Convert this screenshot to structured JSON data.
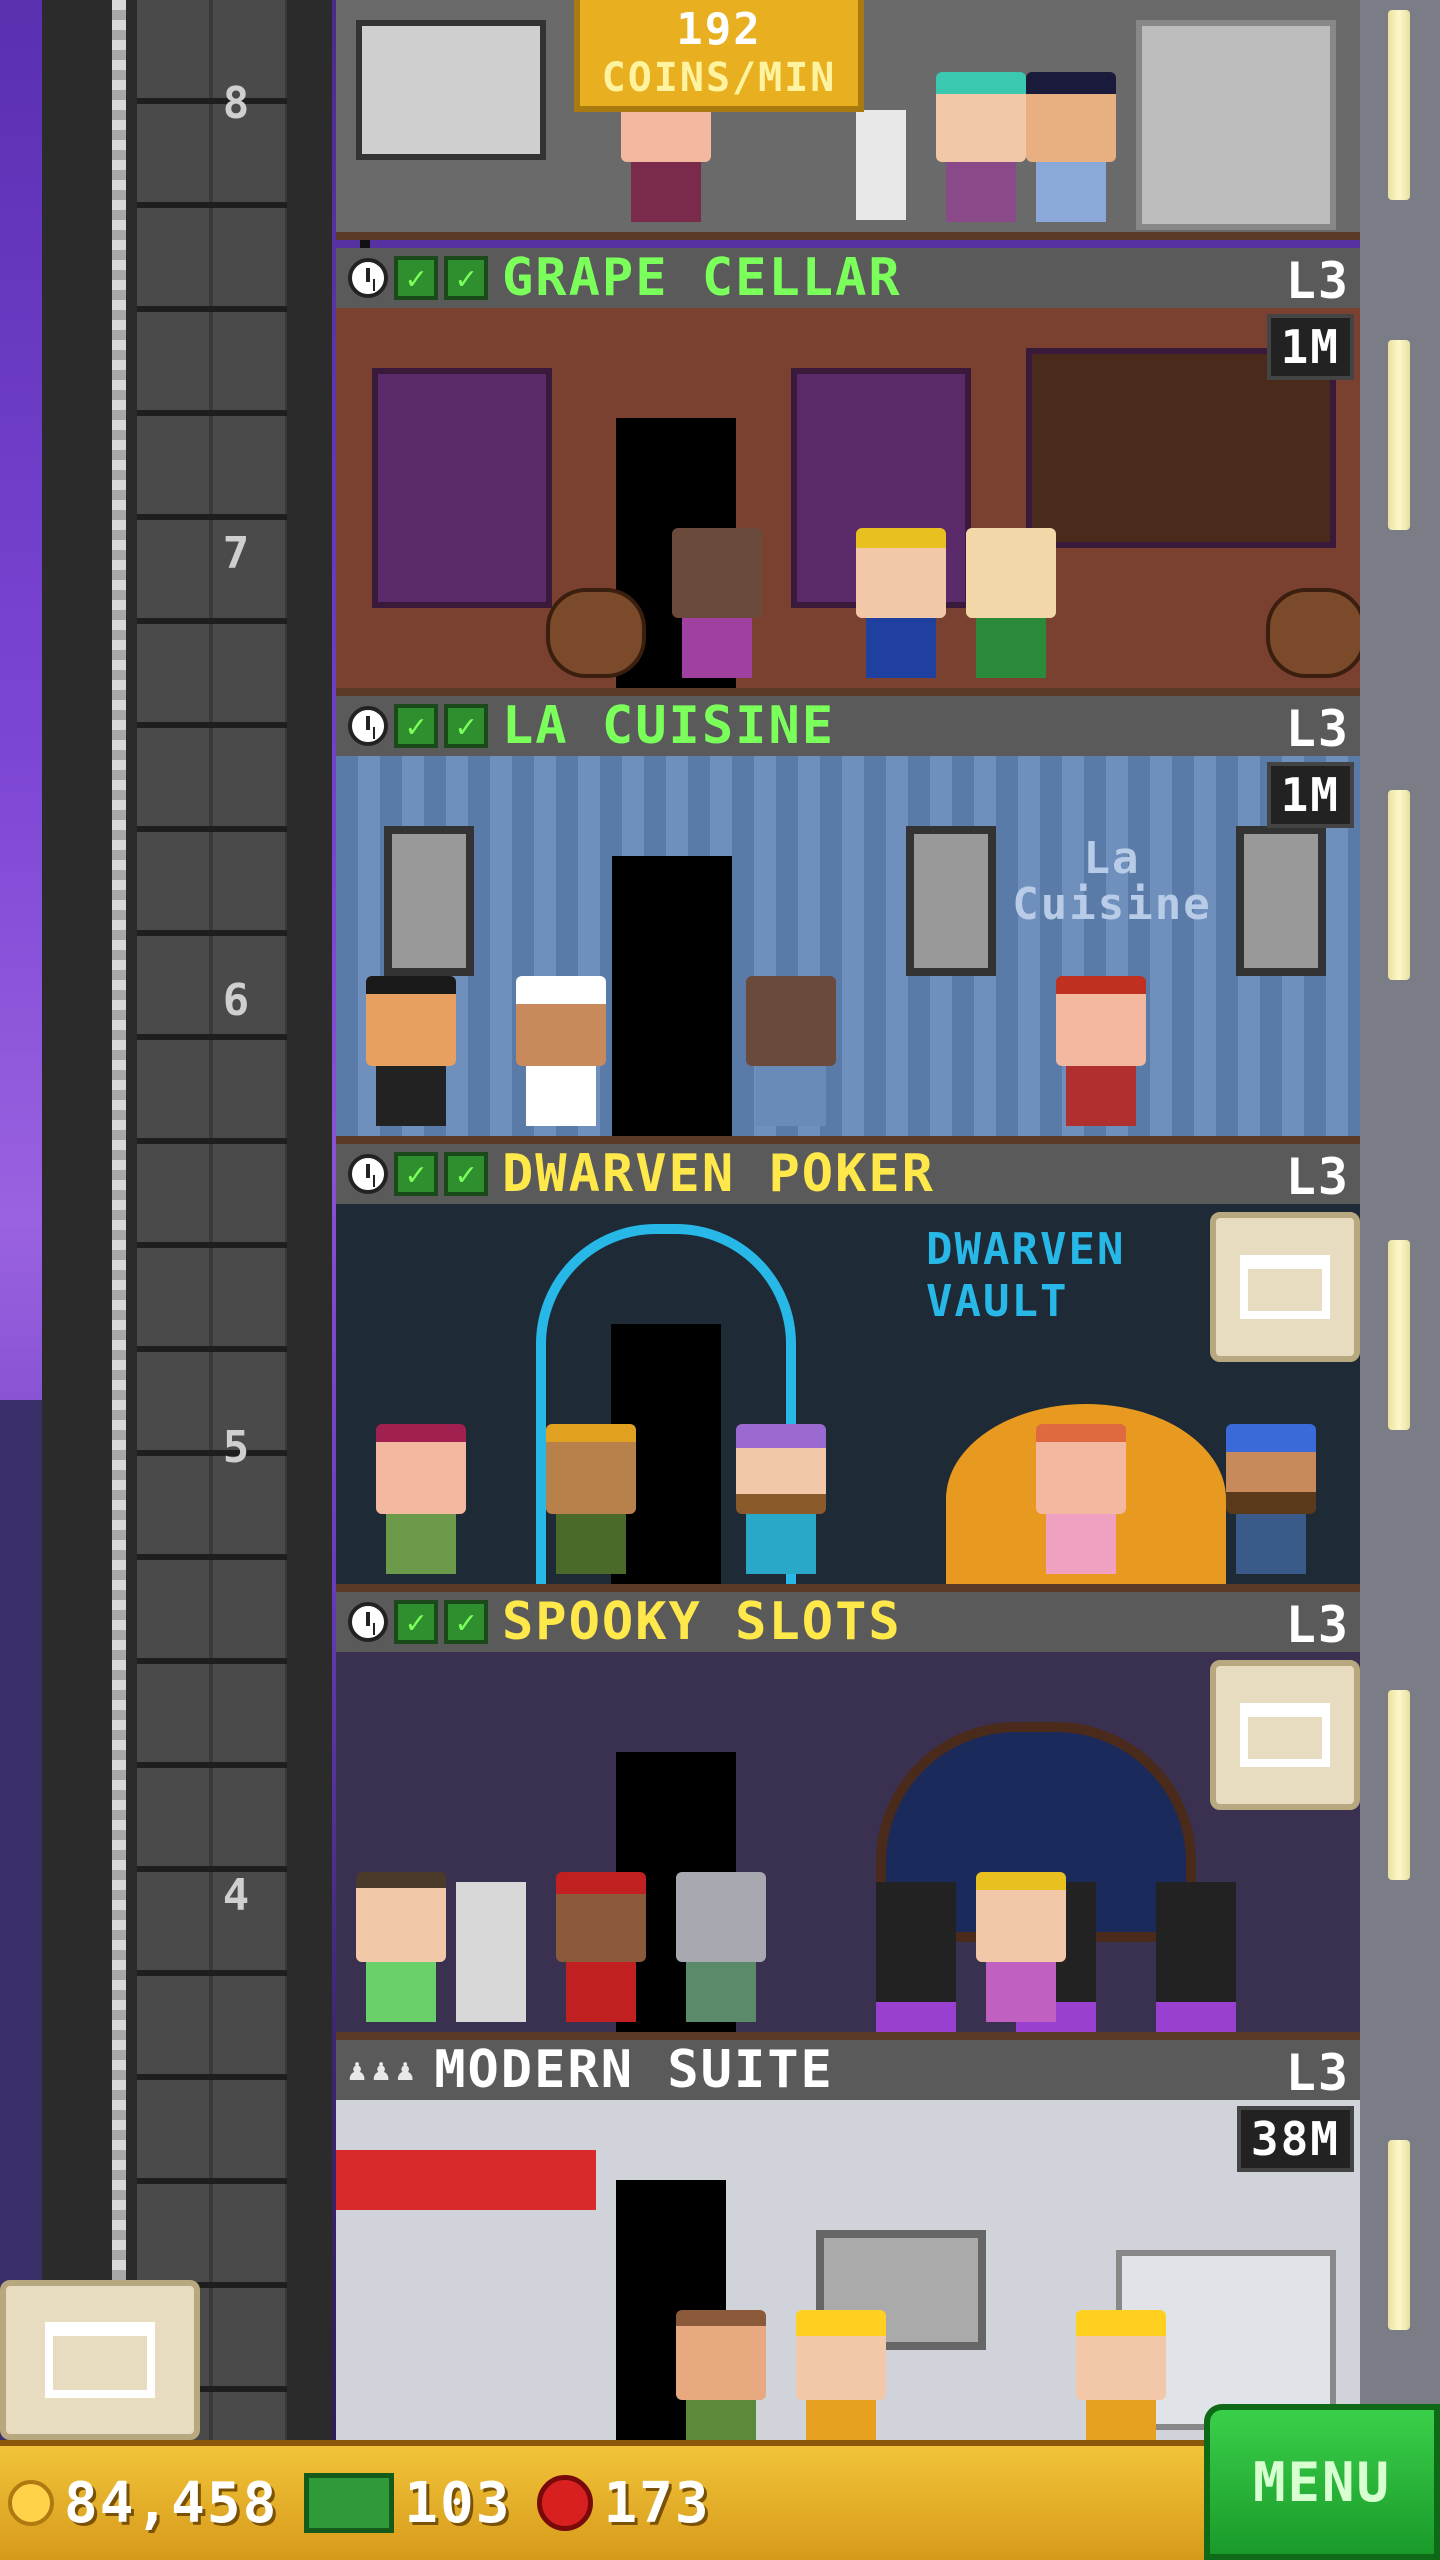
{
  "hud": {
    "coins": "84,458",
    "bux": "103",
    "gems": "173",
    "menu_label": "MENU"
  },
  "coins_per_min": {
    "value": "192",
    "label": "COINS/MIN"
  },
  "shaft_floors": [
    "8",
    "7",
    "6",
    "5",
    "4"
  ],
  "floors": [
    {
      "name": "GRAPE CELLAR",
      "level": "L3",
      "price": "1M",
      "name_color": "#7bff5a",
      "status": "stocked"
    },
    {
      "name": "LA CUISINE",
      "level": "L3",
      "price": "1M",
      "name_color": "#7bff5a",
      "status": "stocked"
    },
    {
      "name": "DWARVEN POKER",
      "level": "L3",
      "name_color": "#ffe84a",
      "status": "restock"
    },
    {
      "name": "SPOOKY SLOTS",
      "level": "L3",
      "name_color": "#ffe84a",
      "status": "restock"
    },
    {
      "name": "MODERN SUITE",
      "level": "L3",
      "price": "38M",
      "name_color": "#ffffff",
      "status": "residential"
    }
  ],
  "signs": {
    "la_cuisine_sign": "La Cuisine",
    "dwarven_vault_sign": "DWARVEN VAULT"
  },
  "icons": {
    "clock": "clock-icon",
    "check": "check-icon",
    "resident": "resident-icon",
    "stock": "stock-box-icon",
    "coin": "coin-icon",
    "bux": "bux-icon",
    "gem": "gem-icon"
  }
}
